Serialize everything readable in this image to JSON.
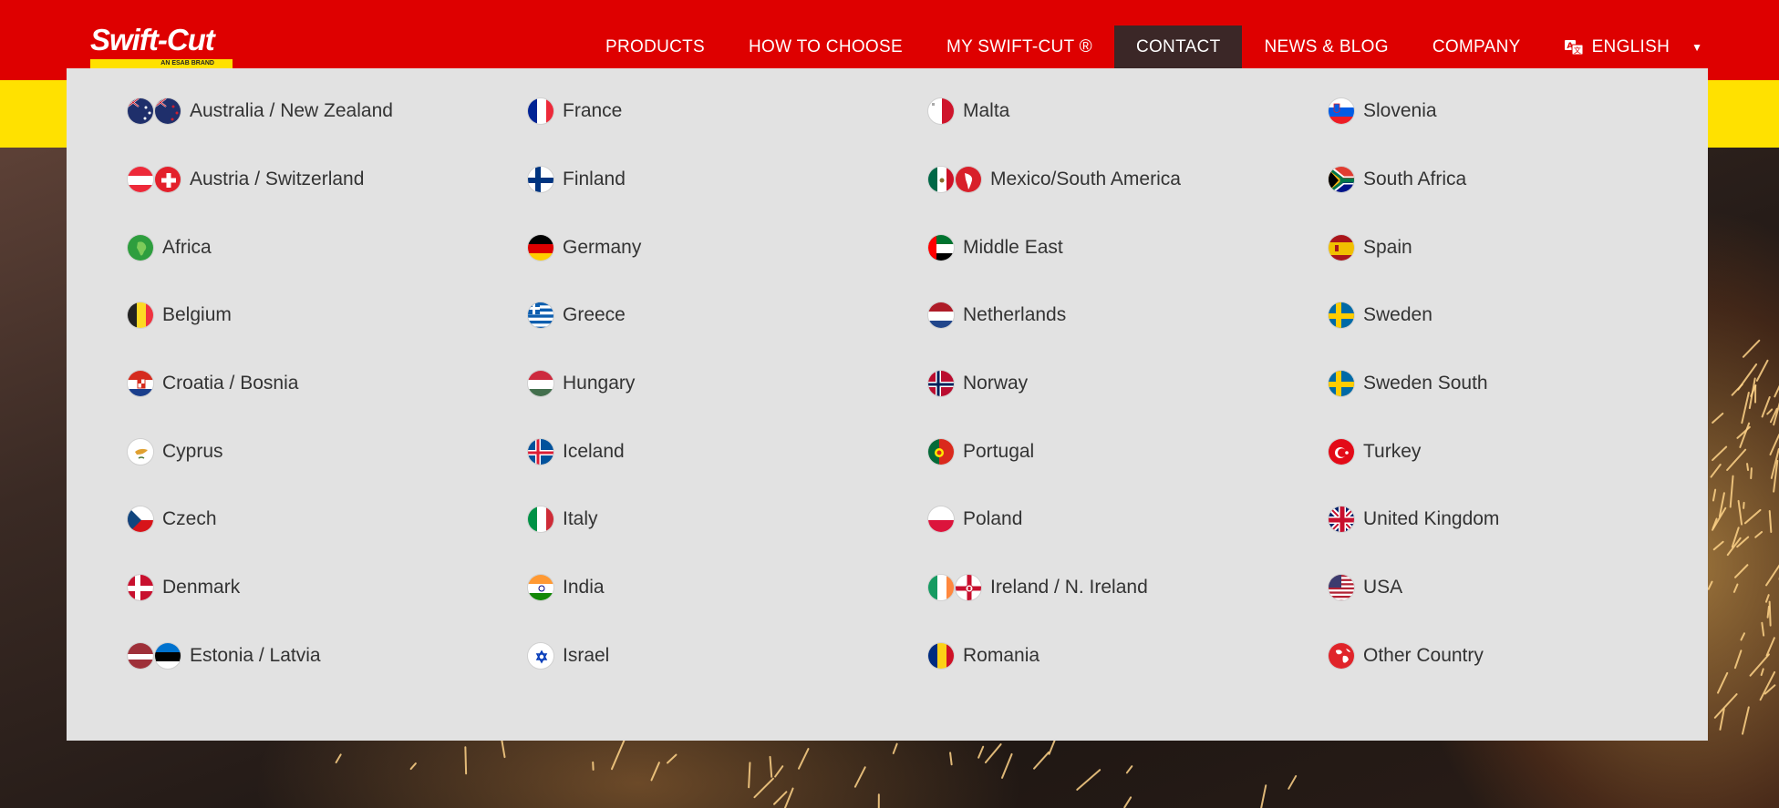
{
  "brand": {
    "logo_text": "Swift-Cut",
    "logo_sub": "AN ESAB BRAND"
  },
  "nav": {
    "items": [
      {
        "label": "PRODUCTS",
        "name": "nav-products"
      },
      {
        "label": "HOW TO CHOOSE",
        "name": "nav-how-to-choose"
      },
      {
        "label": "MY SWIFT-CUT ®",
        "name": "nav-my-swift-cut"
      },
      {
        "label": "CONTACT",
        "name": "nav-contact",
        "active": true
      },
      {
        "label": "NEWS & BLOG",
        "name": "nav-news-blog"
      },
      {
        "label": "COMPANY",
        "name": "nav-company"
      }
    ],
    "language": "ENGLISH"
  },
  "colors": {
    "header_red": "#de0000",
    "band_yellow": "#ffe100",
    "dropdown_bg": "#e2e2e2",
    "active_nav": "#3b2727"
  },
  "countries": [
    {
      "label": "Australia / New Zealand",
      "flags": [
        "au",
        "nz"
      ]
    },
    {
      "label": "Austria / Switzerland",
      "flags": [
        "at",
        "ch"
      ]
    },
    {
      "label": "Africa",
      "flags": [
        "africa"
      ]
    },
    {
      "label": "Belgium",
      "flags": [
        "be"
      ]
    },
    {
      "label": "Croatia / Bosnia",
      "flags": [
        "hr"
      ]
    },
    {
      "label": "Cyprus",
      "flags": [
        "cy"
      ]
    },
    {
      "label": "Czech",
      "flags": [
        "cz"
      ]
    },
    {
      "label": "Denmark",
      "flags": [
        "dk"
      ]
    },
    {
      "label": "Estonia / Latvia",
      "flags": [
        "lv",
        "ee"
      ]
    },
    {
      "label": "France",
      "flags": [
        "fr"
      ]
    },
    {
      "label": "Finland",
      "flags": [
        "fi"
      ]
    },
    {
      "label": "Germany",
      "flags": [
        "de"
      ]
    },
    {
      "label": "Greece",
      "flags": [
        "gr"
      ]
    },
    {
      "label": "Hungary",
      "flags": [
        "hu"
      ]
    },
    {
      "label": "Iceland",
      "flags": [
        "is"
      ]
    },
    {
      "label": "Italy",
      "flags": [
        "it"
      ]
    },
    {
      "label": "India",
      "flags": [
        "in"
      ]
    },
    {
      "label": "Israel",
      "flags": [
        "il"
      ]
    },
    {
      "label": "Malta",
      "flags": [
        "mt"
      ]
    },
    {
      "label": "Mexico/South America",
      "flags": [
        "mx",
        "sa"
      ]
    },
    {
      "label": "Middle East",
      "flags": [
        "me"
      ]
    },
    {
      "label": "Netherlands",
      "flags": [
        "nl"
      ]
    },
    {
      "label": "Norway",
      "flags": [
        "no"
      ]
    },
    {
      "label": "Portugal",
      "flags": [
        "pt"
      ]
    },
    {
      "label": "Poland",
      "flags": [
        "pl"
      ]
    },
    {
      "label": "Ireland / N. Ireland",
      "flags": [
        "ie",
        "ni"
      ]
    },
    {
      "label": "Romania",
      "flags": [
        "ro"
      ]
    },
    {
      "label": "Slovenia",
      "flags": [
        "si"
      ]
    },
    {
      "label": "South Africa",
      "flags": [
        "za"
      ]
    },
    {
      "label": "Spain",
      "flags": [
        "es"
      ]
    },
    {
      "label": "Sweden",
      "flags": [
        "se"
      ]
    },
    {
      "label": "Sweden South",
      "flags": [
        "se"
      ]
    },
    {
      "label": "Turkey",
      "flags": [
        "tr"
      ]
    },
    {
      "label": "United Kingdom",
      "flags": [
        "gb"
      ]
    },
    {
      "label": "USA",
      "flags": [
        "us"
      ]
    },
    {
      "label": "Other Country",
      "flags": [
        "globe"
      ]
    }
  ]
}
